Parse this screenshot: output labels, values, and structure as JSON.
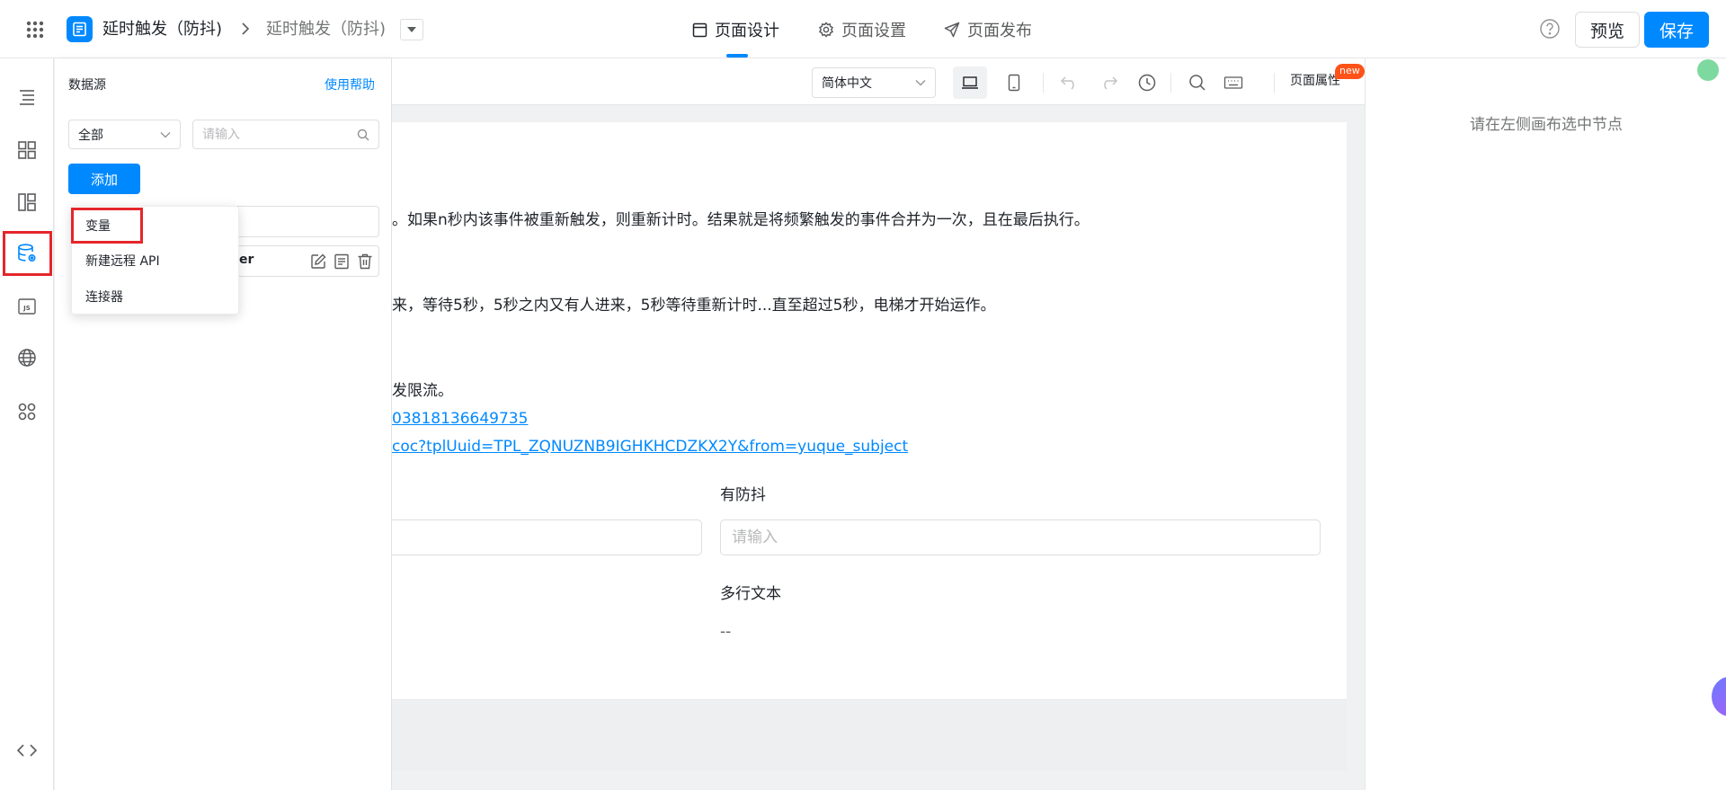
{
  "header": {
    "app_name": "延时触发（防抖)",
    "breadcrumb_page": "延时触发（防抖)",
    "tabs": [
      {
        "label": "页面设计",
        "icon": "layout-icon",
        "active": true
      },
      {
        "label": "页面设置",
        "icon": "gear-icon",
        "active": false
      },
      {
        "label": "页面发布",
        "icon": "send-icon",
        "active": false
      }
    ],
    "preview_label": "预览",
    "save_label": "保存",
    "accent_color": "#0089ff"
  },
  "left_rail": {
    "items": [
      {
        "name": "outline-icon"
      },
      {
        "name": "components-icon"
      },
      {
        "name": "templates-icon"
      },
      {
        "name": "datasource-icon",
        "active": true
      },
      {
        "name": "js-icon"
      },
      {
        "name": "globe-icon"
      },
      {
        "name": "plugins-icon"
      }
    ],
    "bottom_icon": "code-icon"
  },
  "data_panel": {
    "title": "数据源",
    "help_link": "使用帮助",
    "filter_value": "全部",
    "search_placeholder": "请输入",
    "add_label": "添加",
    "row2_text_fragment": "er",
    "add_menu": {
      "items": [
        {
          "label": "变量",
          "highlighted": true
        },
        {
          "label": "新建远程 API"
        },
        {
          "label": "连接器"
        }
      ]
    }
  },
  "canvas_toolbar": {
    "language": "简体中文",
    "page_props_label": "页面属性",
    "new_badge": "new"
  },
  "canvas": {
    "line1": "。如果n秒内该事件被重新触发，则重新计时。结果就是将频繁触发的事件合并为一次，且在最后执行。",
    "line2": "来，等待5秒，5秒之内又有人进来，5秒等待重新计时...直至超过5秒，电梯才开始运作。",
    "line3": "发限流。",
    "link1": "03818136649735",
    "link2": "coc?tplUuid=TPL_ZQNUZNB9IGHKHCDZKX2Y&from=yuque_subject",
    "debounce_label": "有防抖",
    "debounce_placeholder": "请输入",
    "multiline_label": "多行文本",
    "multiline_value": "--"
  },
  "right_panel": {
    "hint": "请在左侧画布选中节点"
  }
}
